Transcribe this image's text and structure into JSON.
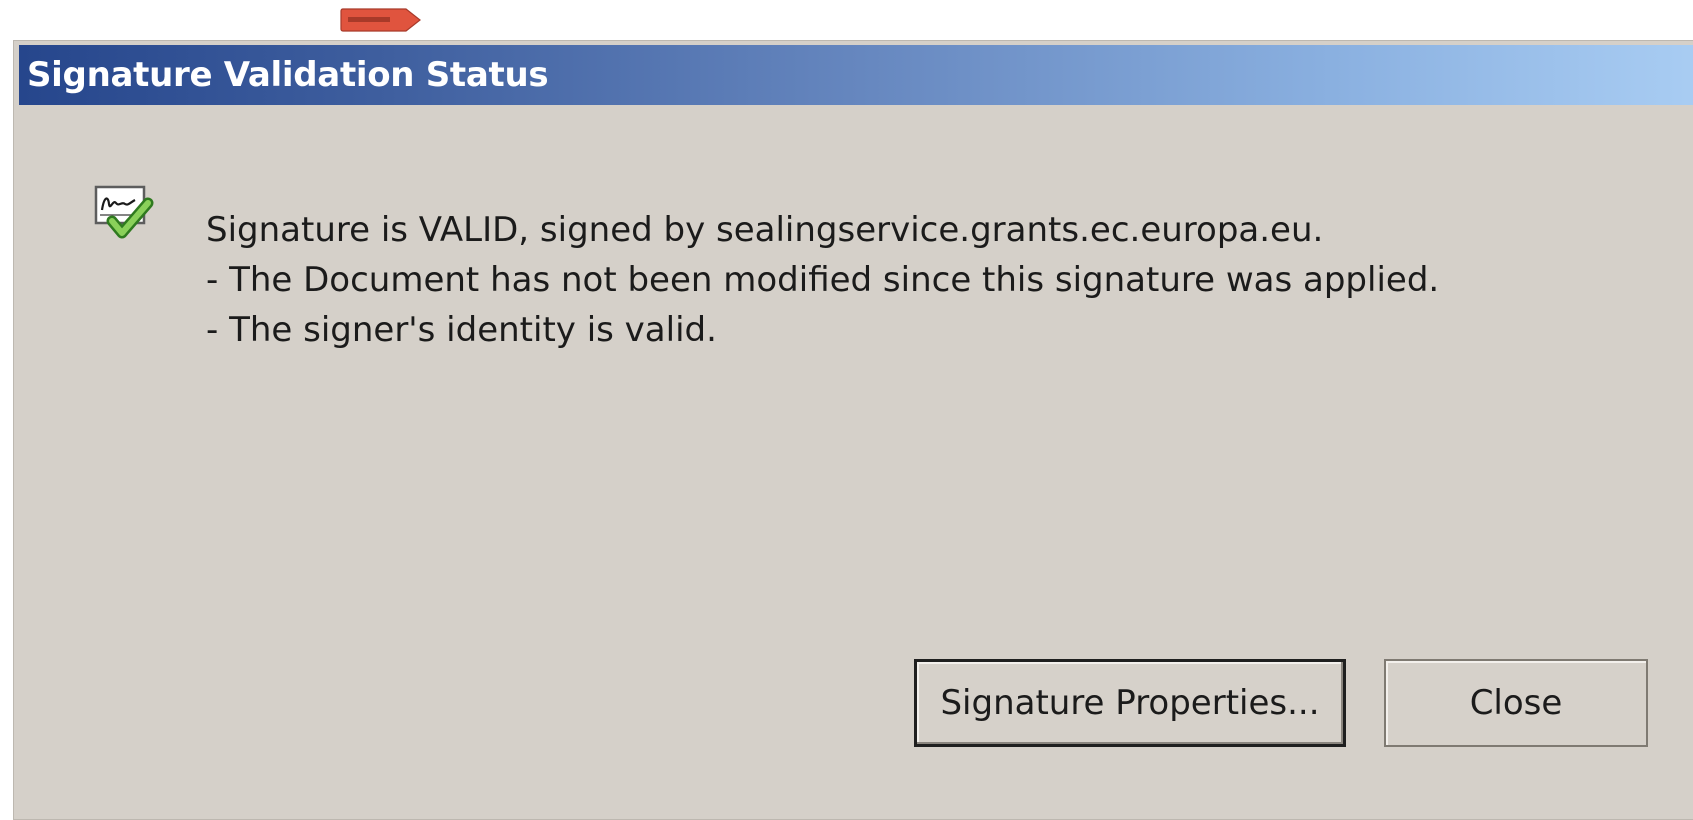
{
  "dialog": {
    "title": "Signature Validation Status",
    "icon": "signature-valid-icon",
    "messages": [
      "Signature is VALID, signed by sealingservice.grants.ec.europa.eu.",
      "- The Document has not been modified since this signature was applied.",
      "- The signer's identity is valid."
    ],
    "buttons": {
      "properties_label": "Signature Properties...",
      "close_label": "Close"
    }
  },
  "colors": {
    "dialog_background": "#d5d0c9",
    "titlebar_start": "#26468c",
    "titlebar_end": "#a9cdf3",
    "title_text": "#ffffff",
    "tag_fill": "#e0543e"
  }
}
